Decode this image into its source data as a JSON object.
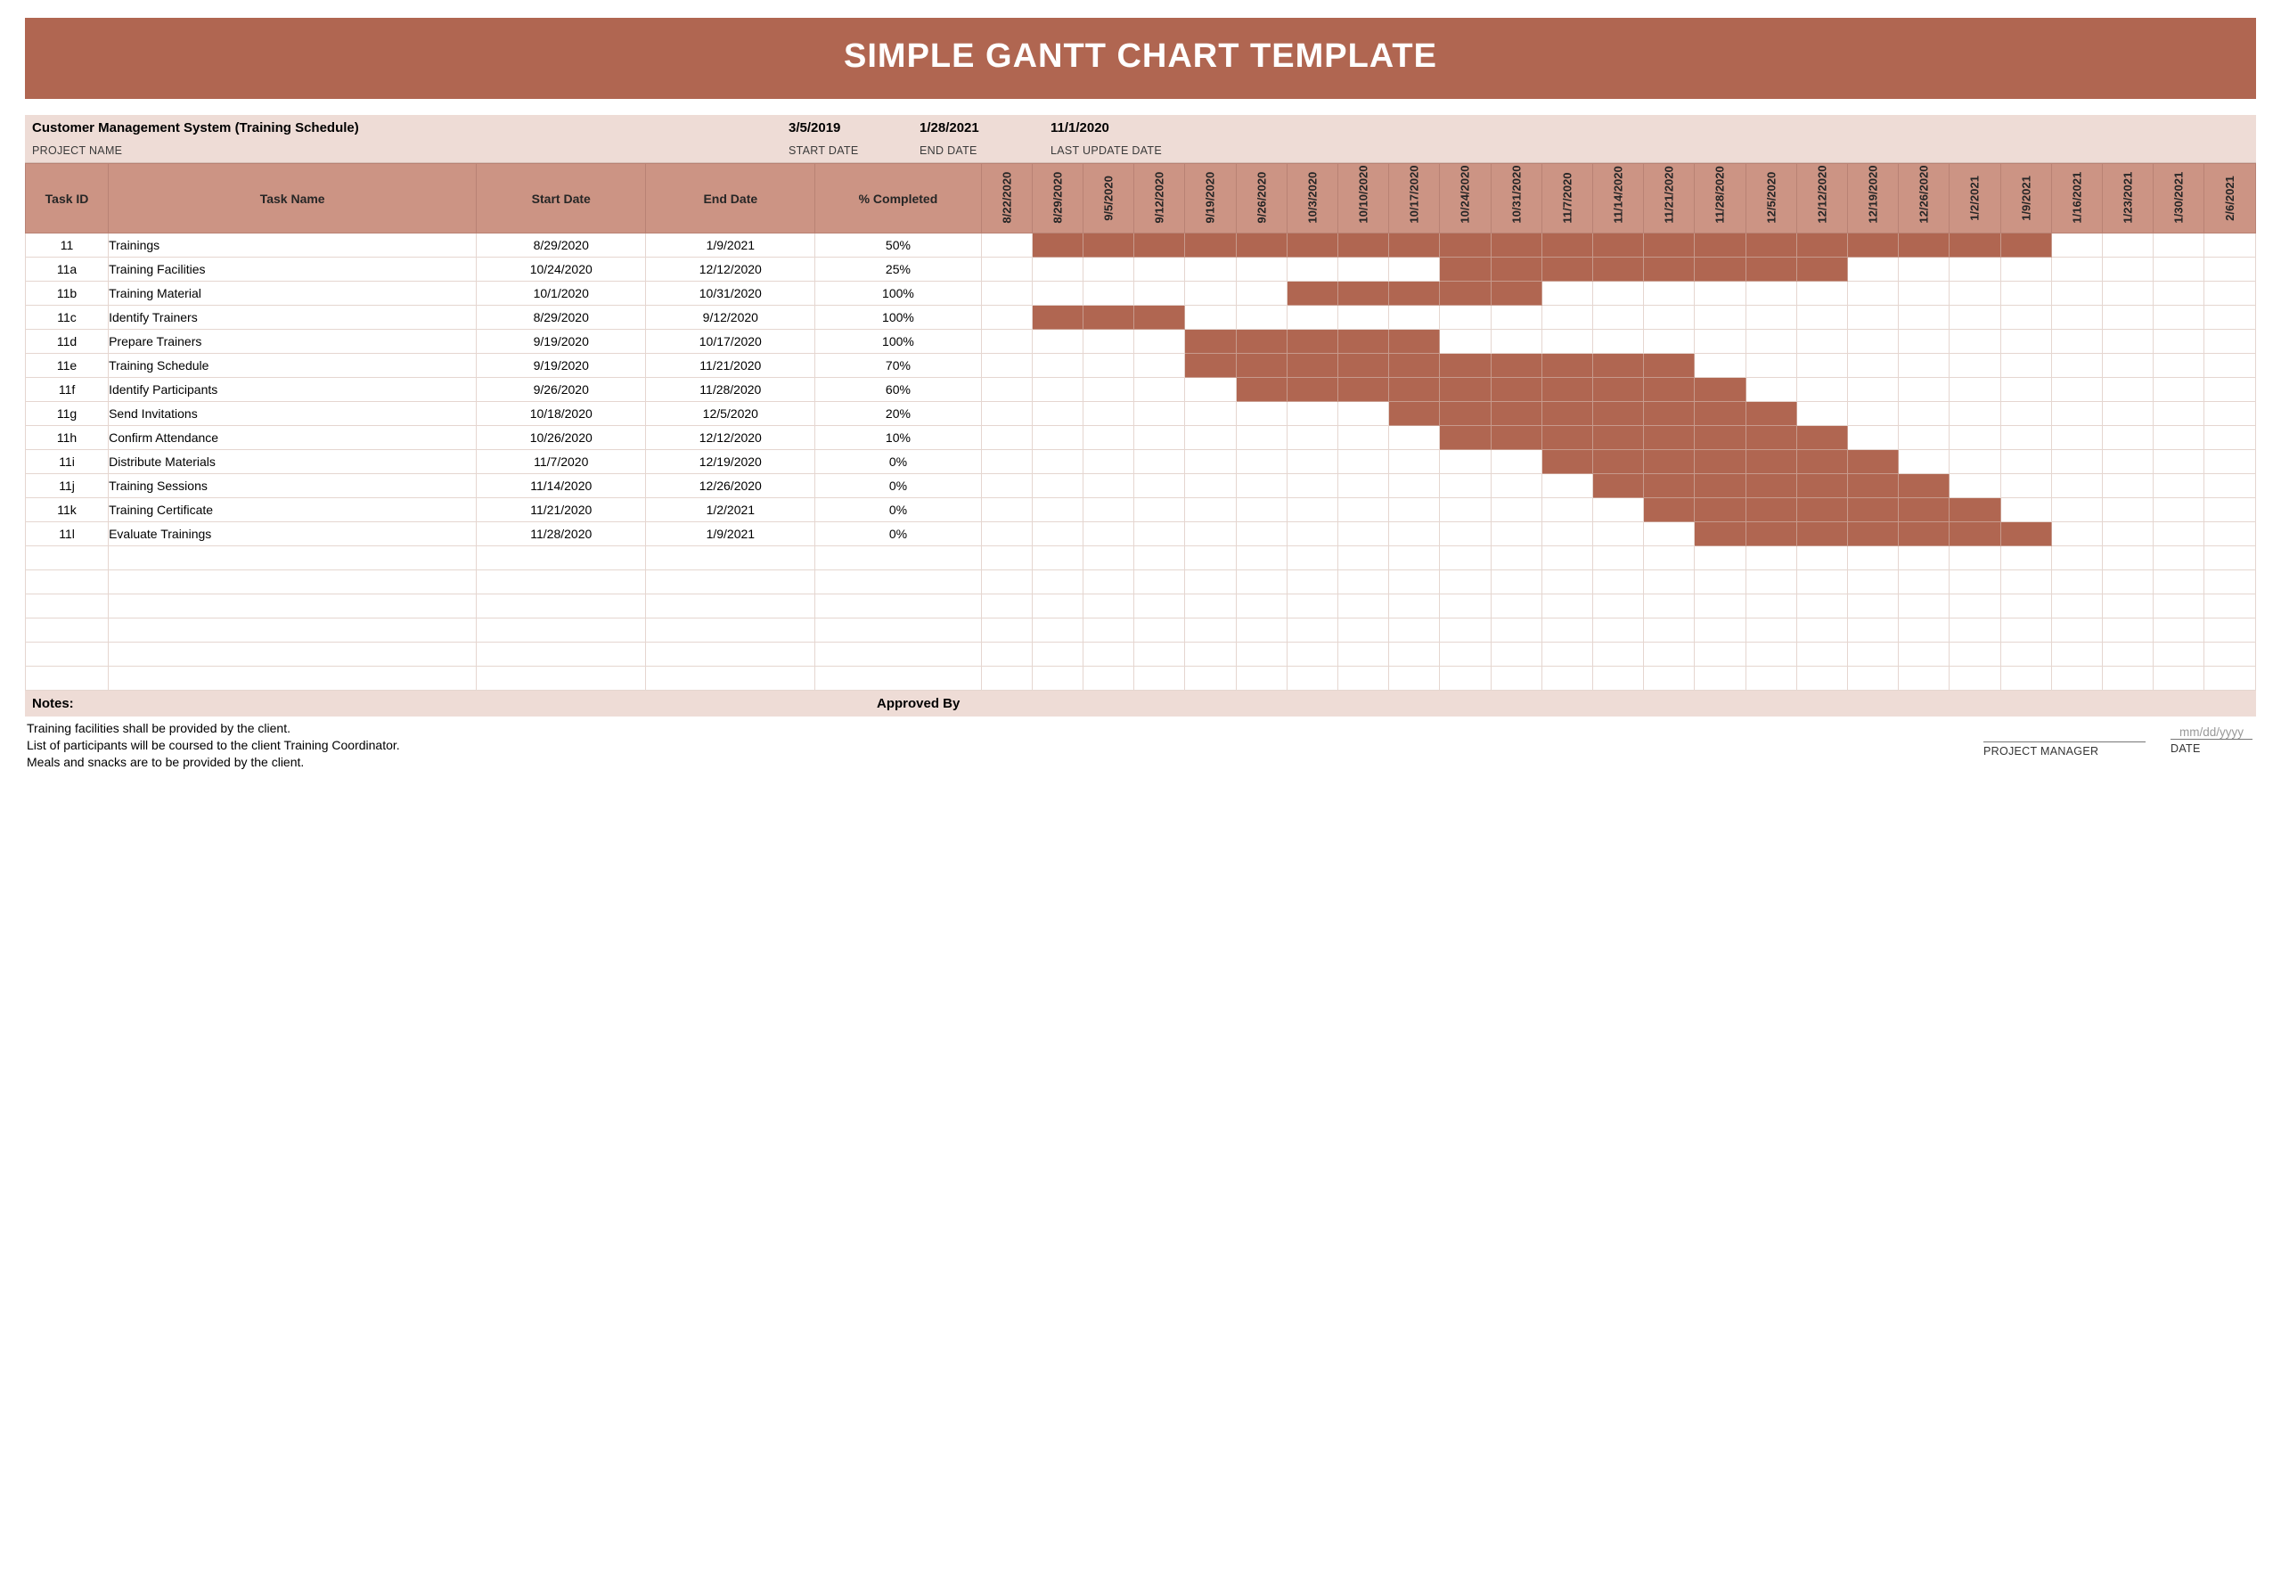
{
  "title": "SIMPLE GANTT CHART TEMPLATE",
  "project": {
    "name_value": "Customer Management System (Training Schedule)",
    "name_label": "PROJECT NAME",
    "start_date_value": "3/5/2019",
    "start_date_label": "START DATE",
    "end_date_value": "1/28/2021",
    "end_date_label": "END DATE",
    "last_update_value": "11/1/2020",
    "last_update_label": "LAST UPDATE DATE"
  },
  "columns": {
    "task_id": "Task ID",
    "task_name": "Task Name",
    "start_date": "Start Date",
    "end_date": "End Date",
    "pct_completed": "% Completed"
  },
  "weeks": [
    "8/22/2020",
    "8/29/2020",
    "9/5/2020",
    "9/12/2020",
    "9/19/2020",
    "9/26/2020",
    "10/3/2020",
    "10/10/2020",
    "10/17/2020",
    "10/24/2020",
    "10/31/2020",
    "11/7/2020",
    "11/14/2020",
    "11/21/2020",
    "11/28/2020",
    "12/5/2020",
    "12/12/2020",
    "12/19/2020",
    "12/26/2020",
    "1/2/2021",
    "1/9/2021",
    "1/16/2021",
    "1/23/2021",
    "1/30/2021",
    "2/6/2021"
  ],
  "rows": [
    {
      "id": "11",
      "name": "Trainings",
      "start": "8/29/2020",
      "end": "1/9/2021",
      "pct": "50%",
      "fill": [
        1,
        2,
        3,
        4,
        5,
        6,
        7,
        8,
        9,
        10,
        11,
        12,
        13,
        14,
        15,
        16,
        17,
        18,
        19,
        20
      ]
    },
    {
      "id": "11a",
      "name": "Training Facilities",
      "start": "10/24/2020",
      "end": "12/12/2020",
      "pct": "25%",
      "fill": [
        9,
        10,
        11,
        12,
        13,
        14,
        15,
        16
      ]
    },
    {
      "id": "11b",
      "name": "Training Material",
      "start": "10/1/2020",
      "end": "10/31/2020",
      "pct": "100%",
      "fill": [
        6,
        7,
        8,
        9,
        10
      ]
    },
    {
      "id": "11c",
      "name": "Identify Trainers",
      "start": "8/29/2020",
      "end": "9/12/2020",
      "pct": "100%",
      "fill": [
        1,
        2,
        3
      ]
    },
    {
      "id": "11d",
      "name": "Prepare Trainers",
      "start": "9/19/2020",
      "end": "10/17/2020",
      "pct": "100%",
      "fill": [
        4,
        5,
        6,
        7,
        8
      ]
    },
    {
      "id": "11e",
      "name": "Training Schedule",
      "start": "9/19/2020",
      "end": "11/21/2020",
      "pct": "70%",
      "fill": [
        4,
        5,
        6,
        7,
        8,
        9,
        10,
        11,
        12,
        13
      ]
    },
    {
      "id": "11f",
      "name": "Identify Participants",
      "start": "9/26/2020",
      "end": "11/28/2020",
      "pct": "60%",
      "fill": [
        5,
        6,
        7,
        8,
        9,
        10,
        11,
        12,
        13,
        14
      ]
    },
    {
      "id": "11g",
      "name": "Send Invitations",
      "start": "10/18/2020",
      "end": "12/5/2020",
      "pct": "20%",
      "fill": [
        8,
        9,
        10,
        11,
        12,
        13,
        14,
        15
      ]
    },
    {
      "id": "11h",
      "name": "Confirm Attendance",
      "start": "10/26/2020",
      "end": "12/12/2020",
      "pct": "10%",
      "fill": [
        9,
        10,
        11,
        12,
        13,
        14,
        15,
        16
      ]
    },
    {
      "id": "11i",
      "name": "Distribute Materials",
      "start": "11/7/2020",
      "end": "12/19/2020",
      "pct": "0%",
      "fill": [
        11,
        12,
        13,
        14,
        15,
        16,
        17
      ]
    },
    {
      "id": "11j",
      "name": "Training Sessions",
      "start": "11/14/2020",
      "end": "12/26/2020",
      "pct": "0%",
      "fill": [
        12,
        13,
        14,
        15,
        16,
        17,
        18
      ]
    },
    {
      "id": "11k",
      "name": "Training Certificate",
      "start": "11/21/2020",
      "end": "1/2/2021",
      "pct": "0%",
      "fill": [
        13,
        14,
        15,
        16,
        17,
        18,
        19
      ]
    },
    {
      "id": "11l",
      "name": "Evaluate Trainings",
      "start": "11/28/2020",
      "end": "1/9/2021",
      "pct": "0%",
      "fill": [
        14,
        15,
        16,
        17,
        18,
        19,
        20
      ]
    }
  ],
  "blank_rows": 6,
  "footer": {
    "notes_label": "Notes:",
    "approved_label": "Approved By",
    "notes_lines": [
      "Training facilities shall be provided by the client.",
      "List of participants will be coursed to the client Training Coordinator.",
      "Meals and snacks are to be provided by the client."
    ],
    "pm_label": "PROJECT MANAGER",
    "date_label": "DATE",
    "date_placeholder": "mm/dd/yyyy"
  },
  "chart_data": {
    "type": "gantt",
    "title": "SIMPLE GANTT CHART TEMPLATE",
    "x_unit": "week_start_date",
    "x_categories": [
      "8/22/2020",
      "8/29/2020",
      "9/5/2020",
      "9/12/2020",
      "9/19/2020",
      "9/26/2020",
      "10/3/2020",
      "10/10/2020",
      "10/17/2020",
      "10/24/2020",
      "10/31/2020",
      "11/7/2020",
      "11/14/2020",
      "11/21/2020",
      "11/28/2020",
      "12/5/2020",
      "12/12/2020",
      "12/19/2020",
      "12/26/2020",
      "1/2/2021",
      "1/9/2021",
      "1/16/2021",
      "1/23/2021",
      "1/30/2021",
      "2/6/2021"
    ],
    "tasks": [
      {
        "id": "11",
        "name": "Trainings",
        "start": "8/29/2020",
        "end": "1/9/2021",
        "percent_complete": 50
      },
      {
        "id": "11a",
        "name": "Training Facilities",
        "start": "10/24/2020",
        "end": "12/12/2020",
        "percent_complete": 25
      },
      {
        "id": "11b",
        "name": "Training Material",
        "start": "10/1/2020",
        "end": "10/31/2020",
        "percent_complete": 100
      },
      {
        "id": "11c",
        "name": "Identify Trainers",
        "start": "8/29/2020",
        "end": "9/12/2020",
        "percent_complete": 100
      },
      {
        "id": "11d",
        "name": "Prepare Trainers",
        "start": "9/19/2020",
        "end": "10/17/2020",
        "percent_complete": 100
      },
      {
        "id": "11e",
        "name": "Training Schedule",
        "start": "9/19/2020",
        "end": "11/21/2020",
        "percent_complete": 70
      },
      {
        "id": "11f",
        "name": "Identify Participants",
        "start": "9/26/2020",
        "end": "11/28/2020",
        "percent_complete": 60
      },
      {
        "id": "11g",
        "name": "Send Invitations",
        "start": "10/18/2020",
        "end": "12/5/2020",
        "percent_complete": 20
      },
      {
        "id": "11h",
        "name": "Confirm Attendance",
        "start": "10/26/2020",
        "end": "12/12/2020",
        "percent_complete": 10
      },
      {
        "id": "11i",
        "name": "Distribute Materials",
        "start": "11/7/2020",
        "end": "12/19/2020",
        "percent_complete": 0
      },
      {
        "id": "11j",
        "name": "Training Sessions",
        "start": "11/14/2020",
        "end": "12/26/2020",
        "percent_complete": 0
      },
      {
        "id": "11k",
        "name": "Training Certificate",
        "start": "11/21/2020",
        "end": "1/2/2021",
        "percent_complete": 0
      },
      {
        "id": "11l",
        "name": "Evaluate Trainings",
        "start": "11/28/2020",
        "end": "1/9/2021",
        "percent_complete": 0
      }
    ]
  }
}
